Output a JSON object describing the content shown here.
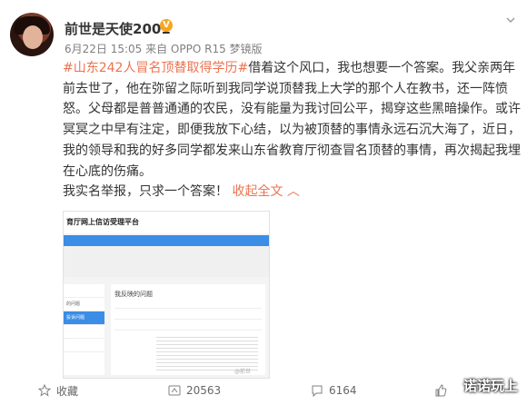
{
  "user": {
    "name": "前世是天使2001",
    "vip_badge": "V",
    "meta": "6月22日 15:05 来自 OPPO R15 梦镜版"
  },
  "post": {
    "hashtag": "#山东242人冒名顶替取得学历#",
    "body": "借着这个风口，我也想要一个答案。我父亲两年前去世了，他在弥留之际听到我同学说顶替我上大学的那个人在教书，还一阵愤怒。父母都是普普通通的农民，没有能量为我讨回公平，揭穿这些黑暗操作。或许冥冥之中早有注定，即便我放下心结，以为被顶替的事情永远石沉大海了，近日，我的领导和我的好多同学都发来山东省教育厅彻查冒名顶替的事情，再次揭起我埋在心底的伤痛。",
    "last_line": "我实名举报，只求一个答案！",
    "collapse_label": "收起全文 ︿"
  },
  "screenshot": {
    "header": "育厅网上信访受理平台",
    "menu_items": [
      "",
      "的问题",
      "投诉问题",
      "",
      ""
    ],
    "panel_title": "我反映的问题",
    "watermark": "@前世"
  },
  "footer": {
    "favorite": "收藏",
    "repost": "20563",
    "comment": "6164",
    "like": ""
  },
  "corner_watermark": "诺诺玩上",
  "colors": {
    "accent": "#eb7350",
    "vip": "#f7a520",
    "link_blue": "#3b8de6"
  }
}
